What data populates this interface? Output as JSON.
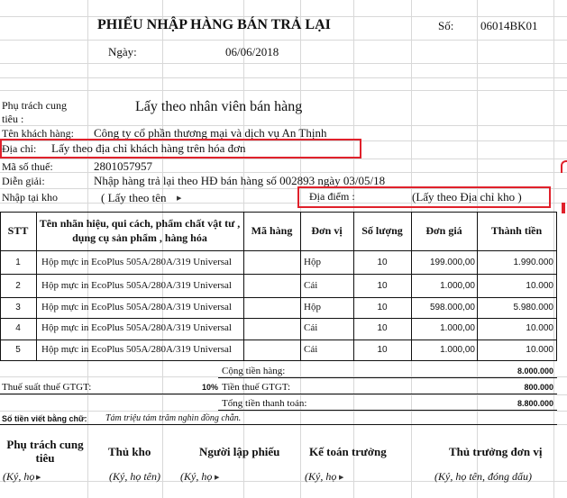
{
  "header": {
    "title": "PHIẾU NHẬP HÀNG BÁN TRẢ LẠI",
    "so_label": "Số:",
    "so_value": "06014BK01",
    "ngay_label": "Ngày:",
    "ngay_value": "06/06/2018"
  },
  "info": {
    "phu_trach_label_1": "Phụ trách cung",
    "phu_trach_label_2": "tiêu :",
    "phu_trach_value": "Lấy theo nhân viên bán hàng",
    "ten_kh_label": "Tên khách hàng:",
    "ten_kh_value": "Công ty cổ phần thương mại và dịch vụ An Thịnh",
    "dia_chi_label": "Địa chỉ:",
    "dia_chi_value": "Lấy theo địa chỉ khách hàng trên hóa đơn",
    "mst_label": "Mã số thuế:",
    "mst_value": "2801057957",
    "dien_giai_label": "Diễn giải:",
    "dien_giai_value": "Nhập hàng trả lại theo HĐ bán hàng số 002893 ngày 03/05/18",
    "nhap_kho_label": "Nhập tại kho",
    "nhap_kho_value": "( Lấy theo tên",
    "dia_diem_label": "Địa điểm :",
    "dia_diem_value": "(Lấy theo Địa chỉ kho )"
  },
  "table": {
    "headers": {
      "stt": "STT",
      "ten_1": "Tên nhãn hiệu, qui cách, phẩm chất vật tư ,",
      "ten_2": "dụng cụ sản phẩm , hàng hóa",
      "ma_hang": "Mã hàng",
      "don_vi": "Đơn vị",
      "so_luong": "Số lượng",
      "don_gia": "Đơn giá",
      "thanh_tien": "Thành tiền"
    },
    "rows": [
      {
        "stt": "1",
        "ten": "Hộp mực in EcoPlus 505A/280A/319 Universal",
        "don_vi": "Hộp",
        "so_luong": "10",
        "don_gia": "199.000,00",
        "thanh_tien": "1.990.000"
      },
      {
        "stt": "2",
        "ten": "Hộp mực in EcoPlus 505A/280A/319 Universal",
        "don_vi": "Cái",
        "so_luong": "10",
        "don_gia": "1.000,00",
        "thanh_tien": "10.000"
      },
      {
        "stt": "3",
        "ten": "Hộp mực in EcoPlus 505A/280A/319 Universal",
        "don_vi": "Hộp",
        "so_luong": "10",
        "don_gia": "598.000,00",
        "thanh_tien": "5.980.000"
      },
      {
        "stt": "4",
        "ten": "Hộp mực in EcoPlus 505A/280A/319 Universal",
        "don_vi": "Cái",
        "so_luong": "10",
        "don_gia": "1.000,00",
        "thanh_tien": "10.000"
      },
      {
        "stt": "5",
        "ten": "Hộp mực in EcoPlus 505A/280A/319 Universal",
        "don_vi": "Cái",
        "so_luong": "10",
        "don_gia": "1.000,00",
        "thanh_tien": "10.000"
      }
    ]
  },
  "totals": {
    "cong_tien_label": "Cộng tiền hàng:",
    "cong_tien_value": "8.000.000",
    "thue_suat_label": "Thuế suất thuế GTGT:",
    "thue_suat_value": "10%",
    "tien_thue_label": "Tiền thuế GTGT:",
    "tien_thue_value": "800.000",
    "tong_tien_label": "Tổng tiền thanh toán:",
    "tong_tien_value": "8.800.000",
    "bang_chu_label": "Số tiền viết bằng chữ:",
    "bang_chu_value": "Tám triệu tám trăm nghìn đồng chẵn."
  },
  "signatures": {
    "phu_trach_1": "Phụ trách cung",
    "phu_trach_2": "tiêu",
    "thu_kho": "Thủ kho",
    "nguoi_lap": "Người lập phiếu",
    "ke_toan": "Kế toán trưởng",
    "thu_truong": "Thủ trưởng đơn vị",
    "sub_1": "(Ký, họ",
    "sub_2": "(Ký, họ tên)",
    "sub_3": "(Ký, họ",
    "sub_4": "(Ký, họ",
    "sub_5": "(Ký, họ tên, đóng dấu)"
  }
}
